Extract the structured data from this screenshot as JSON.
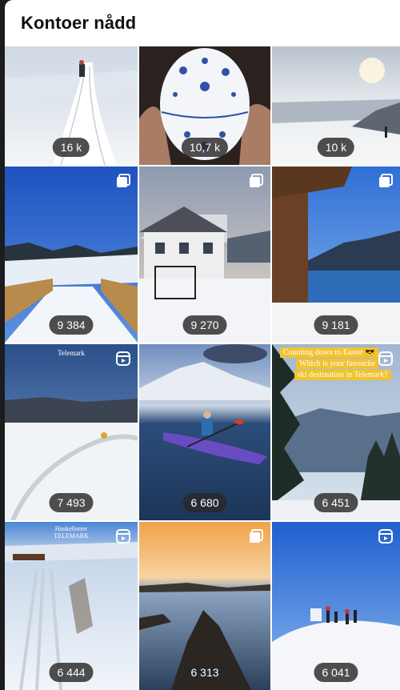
{
  "header": {
    "title": "Kontoer nådd"
  },
  "tiles": [
    {
      "count": "16 k",
      "icon": "none"
    },
    {
      "count": "10,7 k",
      "icon": "none"
    },
    {
      "count": "10 k",
      "icon": "none"
    },
    {
      "count": "9 384",
      "icon": "carousel-icon"
    },
    {
      "count": "9 270",
      "icon": "carousel-icon"
    },
    {
      "count": "9 181",
      "icon": "carousel-icon"
    },
    {
      "count": "7 493",
      "icon": "reel-icon",
      "overlay": "Telemark"
    },
    {
      "count": "6 680",
      "icon": "none"
    },
    {
      "count": "6 451",
      "icon": "reel-icon",
      "overlay_lines": [
        "Counting down to Easter 😎",
        "Which is your favourite",
        "ski destination in Telemark?"
      ]
    },
    {
      "count": "6 444",
      "icon": "reel-icon",
      "overlay_lines": [
        "Haukeliseter",
        "TELEMARK"
      ]
    },
    {
      "count": "6 313",
      "icon": "carousel-icon"
    },
    {
      "count": "6 041",
      "icon": "reel-icon"
    }
  ]
}
